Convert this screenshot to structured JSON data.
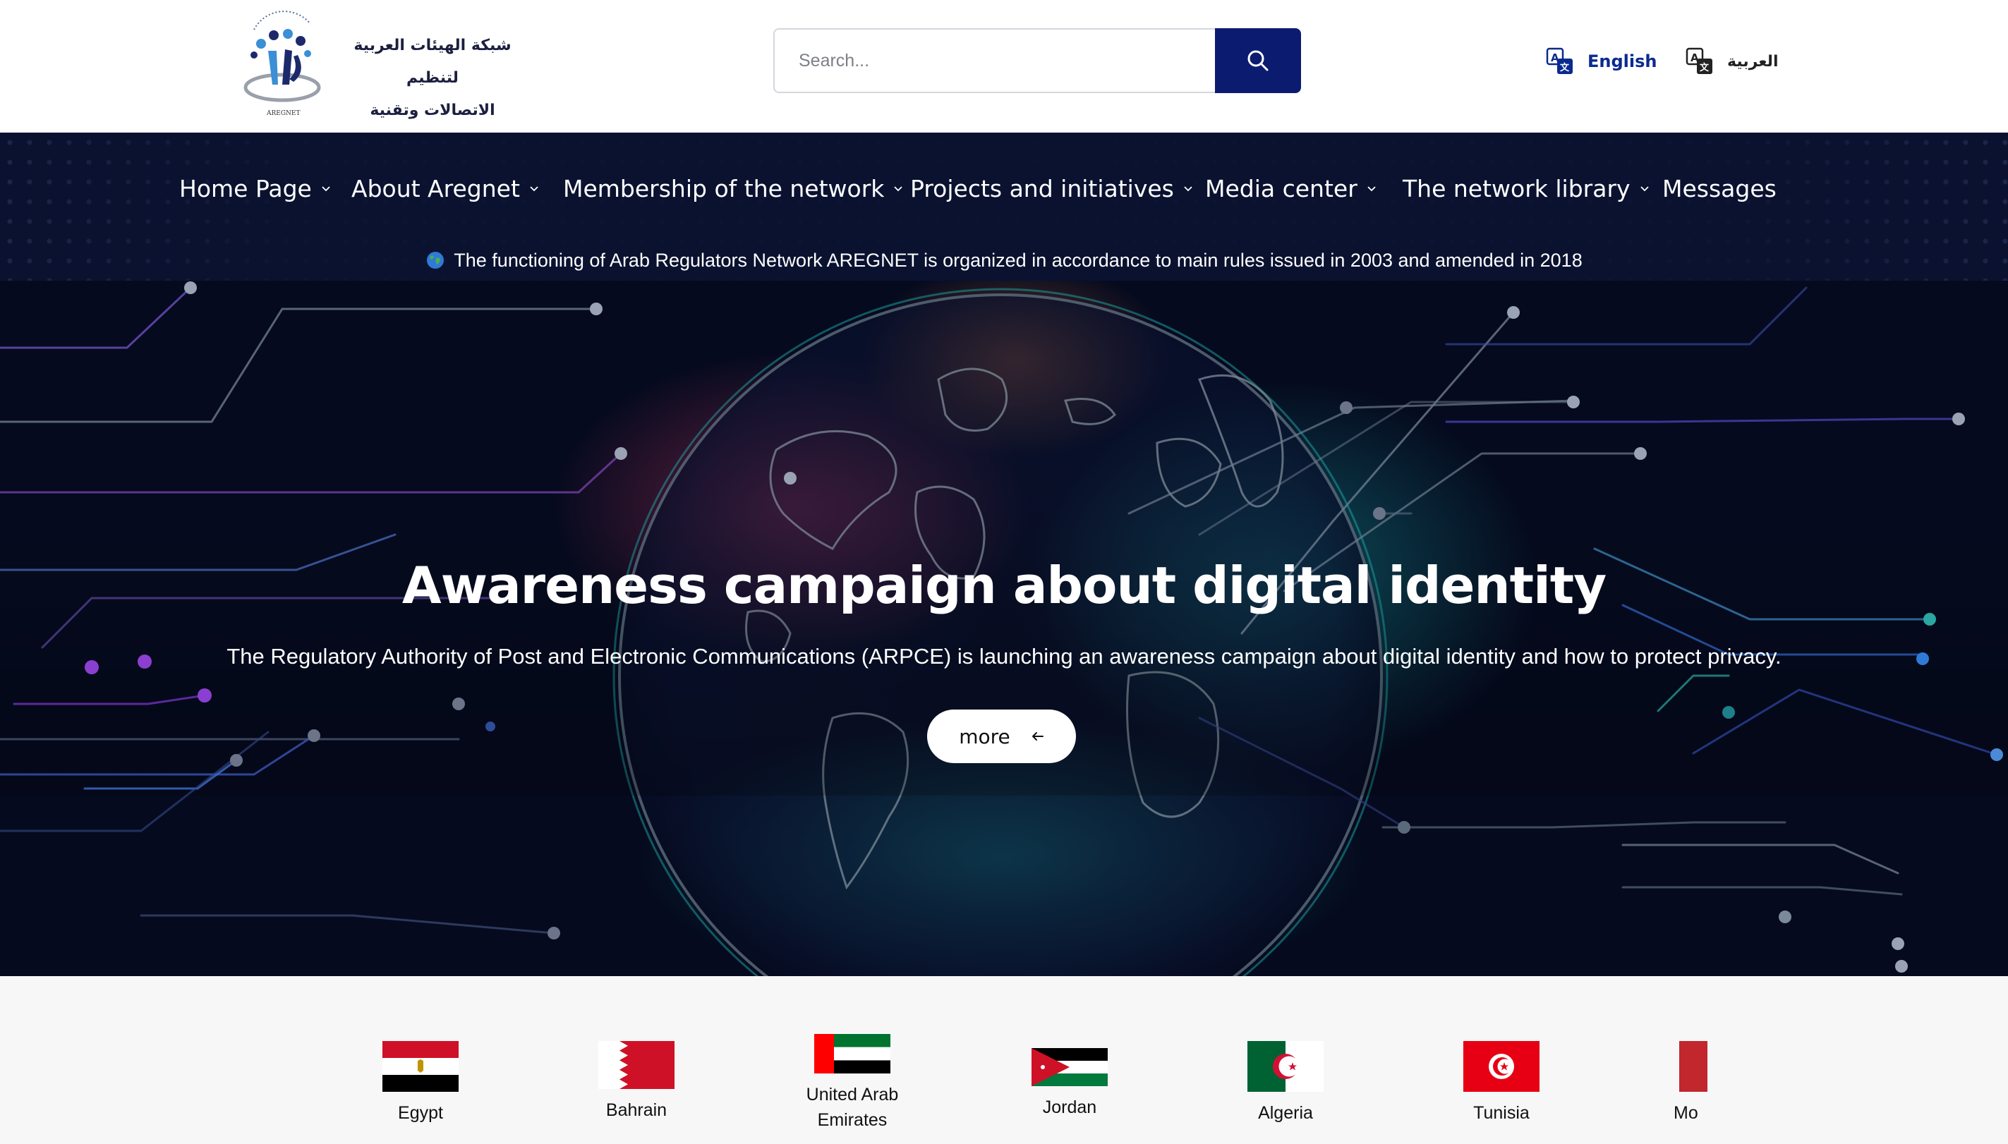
{
  "header": {
    "logo": {
      "arabic_line1": "شبكة الهيئات العربية  لتنظيم",
      "arabic_line2": "الاتصالات وتقنية المعلومات",
      "mark_caption": "AREGNET"
    },
    "search": {
      "placeholder": "Search..."
    },
    "languages": [
      {
        "label": "English",
        "icon": "translate-icon",
        "active": true
      },
      {
        "label": "العربية",
        "icon": "translate-icon",
        "active": false
      }
    ]
  },
  "nav": {
    "items": [
      {
        "label": "Home Page",
        "has_dropdown": true
      },
      {
        "label": "About Aregnet",
        "has_dropdown": true
      },
      {
        "label": "Membership of the network",
        "has_dropdown": true
      },
      {
        "label": "Projects and initiatives",
        "has_dropdown": true
      },
      {
        "label": "Media center",
        "has_dropdown": true
      },
      {
        "label": "The network library",
        "has_dropdown": true
      },
      {
        "label": "Messages",
        "has_dropdown": false
      }
    ],
    "ticker": {
      "icon": "globe-icon",
      "text": "The functioning of Arab Regulators Network AREGNET is organized in accordance to main rules issued in 2003 and amended in 2018"
    }
  },
  "hero": {
    "title": "Awareness campaign about digital identity",
    "description": "The Regulatory Authority of Post and Electronic Communications (ARPCE) is launching an awareness campaign about digital identity and how to protect privacy.",
    "button_label": "more",
    "button_icon": "arrow-left-icon"
  },
  "countries": [
    {
      "name": "Egypt"
    },
    {
      "name": "Bahrain"
    },
    {
      "name": "United Arab Emirates",
      "line1": "United Arab",
      "line2": "Emirates"
    },
    {
      "name": "Jordan"
    },
    {
      "name": "Algeria"
    },
    {
      "name": "Tunisia"
    },
    {
      "name": "Mo"
    }
  ],
  "colors": {
    "nav_bg": "#0a1230",
    "search_button": "#0b1c70",
    "language_active": "#0b2a8f",
    "hero_bg": "#050a1e"
  }
}
